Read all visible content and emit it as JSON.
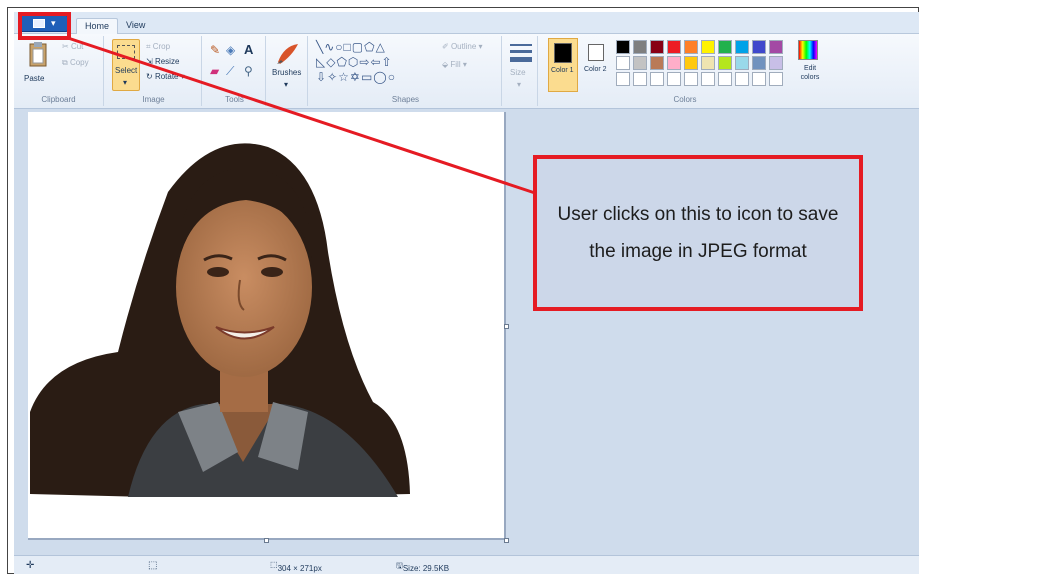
{
  "ribbon": {
    "file_menu_label": "File menu",
    "tabs": [
      {
        "label": "Home"
      },
      {
        "label": "View"
      }
    ],
    "clipboard": {
      "paste": "Paste",
      "cut": "Cut",
      "copy": "Copy",
      "label": "Clipboard"
    },
    "image": {
      "select": "Select",
      "crop": "Crop",
      "resize": "Resize",
      "rotate": "Rotate",
      "label": "Image"
    },
    "tools": {
      "text_tool": "A",
      "label": "Tools"
    },
    "brushes": {
      "label": "Brushes"
    },
    "shapes": {
      "outline": "Outline",
      "fill": "Fill",
      "label": "Shapes"
    },
    "size": {
      "label": "Size"
    },
    "colors": {
      "color1": "Color 1",
      "color2": "Color 2",
      "edit_colors": "Edit colors",
      "label": "Colors",
      "color1_value": "#000000",
      "color2_value": "#ffffff",
      "palette_row1": [
        "#000000",
        "#7f7f7f",
        "#880015",
        "#ed1c24",
        "#ff7f27",
        "#fff200",
        "#22b14c",
        "#00a2e8",
        "#3f48cc",
        "#a349a4"
      ],
      "palette_row2": [
        "#ffffff",
        "#c3c3c3",
        "#b97a57",
        "#ffaec9",
        "#ffc90e",
        "#efe4b0",
        "#b5e61d",
        "#99d9ea",
        "#7092be",
        "#c8bfe7"
      ]
    }
  },
  "statusbar": {
    "dimensions": "304 × 271px",
    "size": "Size: 29.5KB"
  },
  "annotation": {
    "text": "User clicks on this to icon to save the image in JPEG format",
    "color": "#e51b23"
  }
}
